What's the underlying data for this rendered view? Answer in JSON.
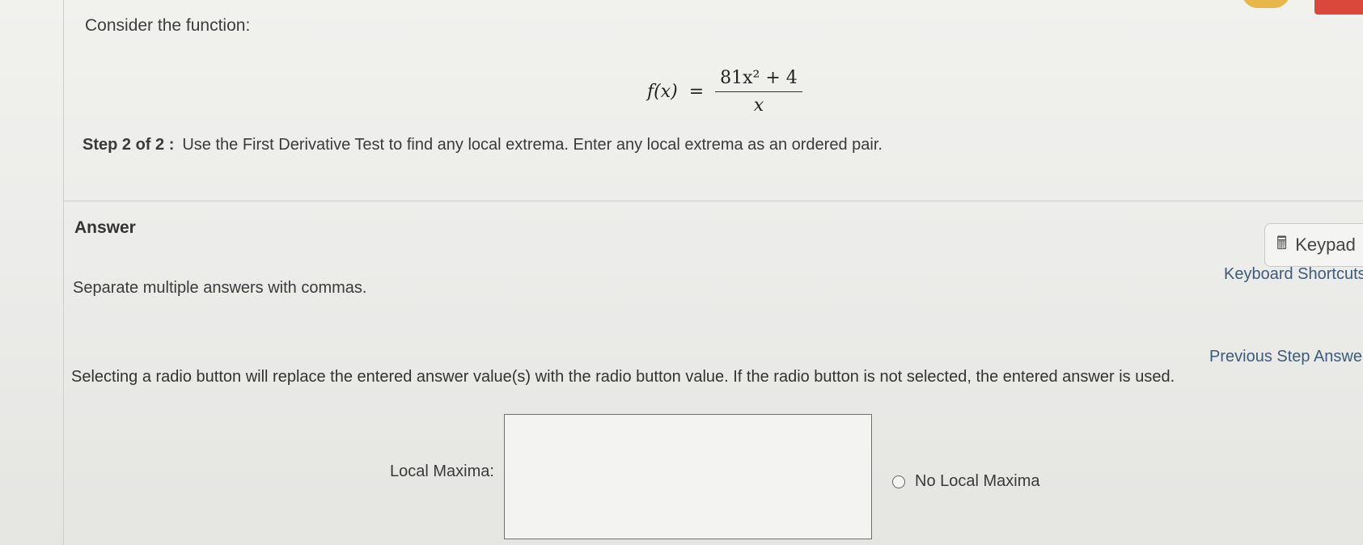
{
  "question": {
    "intro": "Consider the function:",
    "formula": {
      "lhs": "f(x)",
      "equals": "=",
      "numerator": "81x² + 4",
      "denominator": "x"
    },
    "step_label": "Step 2 of 2 :",
    "step_text": "Use the First Derivative Test to find any local extrema. Enter any local extrema as an ordered pair."
  },
  "answer": {
    "heading": "Answer",
    "keypad_label": "Keypad",
    "keypad_icon": "calculator-icon",
    "keyboard_shortcuts_label": "Keyboard Shortcuts",
    "separate_note": "Separate multiple answers with commas.",
    "previous_step_label": "Previous Step Answers",
    "radio_note": "Selecting a radio button will replace the entered answer value(s) with the radio button value. If the radio button is not selected, the entered answer is used.",
    "local_maxima_label": "Local Maxima:",
    "local_maxima_value": "",
    "no_local_maxima_label": "No Local Maxima",
    "no_local_maxima_selected": false
  },
  "colors": {
    "link": "#3f5b7a",
    "avatar": "#e8b64a",
    "corner_tab": "#d9483b"
  }
}
